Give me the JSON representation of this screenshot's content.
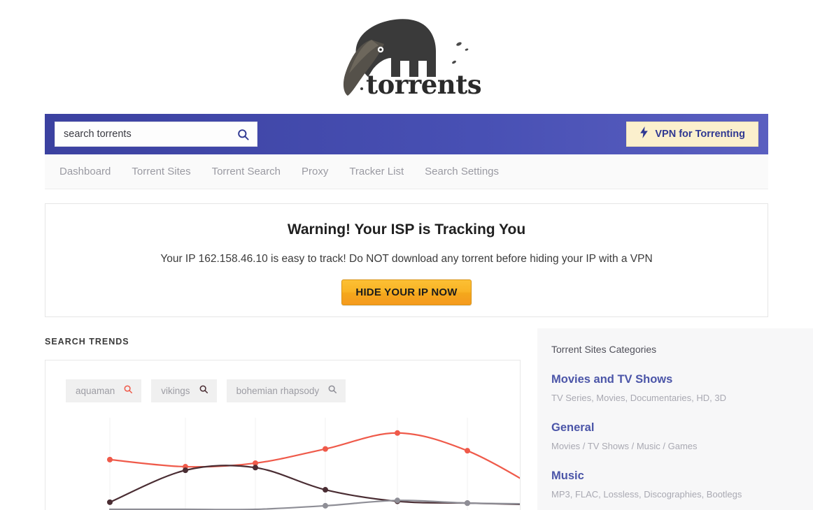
{
  "brand": {
    "wordmark": "torrents",
    "logo_icon": "anteater-logo"
  },
  "search": {
    "placeholder": "search torrents",
    "value": "",
    "icon": "search-icon"
  },
  "vpn_button": {
    "label": "VPN for Torrenting",
    "icon": "lightning-bolt-icon"
  },
  "nav": {
    "items": [
      {
        "label": "Dashboard"
      },
      {
        "label": "Torrent Sites"
      },
      {
        "label": "Torrent Search"
      },
      {
        "label": "Proxy"
      },
      {
        "label": "Tracker List"
      },
      {
        "label": "Search Settings"
      }
    ]
  },
  "warning": {
    "title": "Warning! Your ISP is Tracking You",
    "subtitle": "Your IP 162.158.46.10 is easy to track! Do NOT download any torrent before hiding your IP with a VPN",
    "ip": "162.158.46.10",
    "button_label": "HIDE YOUR IP NOW"
  },
  "trends": {
    "section_label": "SEARCH TRENDS",
    "chips": [
      {
        "label": "aquaman",
        "icon": "search-icon",
        "color": "#ef5a4a"
      },
      {
        "label": "vikings",
        "icon": "search-icon",
        "color": "#4a2d33"
      },
      {
        "label": "bohemian rhapsody",
        "icon": "search-icon",
        "color": "#8e8e96"
      }
    ]
  },
  "sidebar": {
    "title": "Torrent Sites Categories",
    "categories": [
      {
        "name": "Movies and TV Shows",
        "desc": "TV Series, Movies, Documentaries, HD, 3D"
      },
      {
        "name": "General",
        "desc": "Movies / TV Shows / Music / Games"
      },
      {
        "name": "Music",
        "desc": "MP3, FLAC, Lossless, Discographies, Bootlegs"
      }
    ]
  },
  "colors": {
    "header_blue_left": "#3b41a0",
    "header_blue_right": "#5a5fc0",
    "vpn_cream": "#fbf0cd",
    "vpn_text": "#2f3892",
    "cta_orange": "#f9b325",
    "sidebar_link": "#4b55a8",
    "series_aquaman": "#ef5a4a",
    "series_vikings": "#4a2d33",
    "series_bohemian": "#8e8e96"
  },
  "chart_data": {
    "type": "line",
    "title": "",
    "xlabel": "",
    "ylabel": "",
    "grid": true,
    "grid_x_positions": [
      92,
      200,
      300,
      400,
      503,
      603,
      707
    ],
    "legend_position": "top-left-chips",
    "x": [
      1,
      2,
      3,
      4,
      5,
      6,
      7
    ],
    "ylim": [
      0,
      100
    ],
    "series": [
      {
        "name": "aquaman",
        "color": "#ef5a4a",
        "values": [
          56,
          48,
          52,
          68,
          86,
          66,
          22
        ]
      },
      {
        "name": "vikings",
        "color": "#4a2d33",
        "values": [
          8,
          44,
          47,
          22,
          9,
          7,
          5
        ]
      },
      {
        "name": "bohemian rhapsody",
        "color": "#8e8e96",
        "values": [
          0,
          0,
          0,
          4,
          10,
          7,
          6
        ]
      }
    ]
  }
}
